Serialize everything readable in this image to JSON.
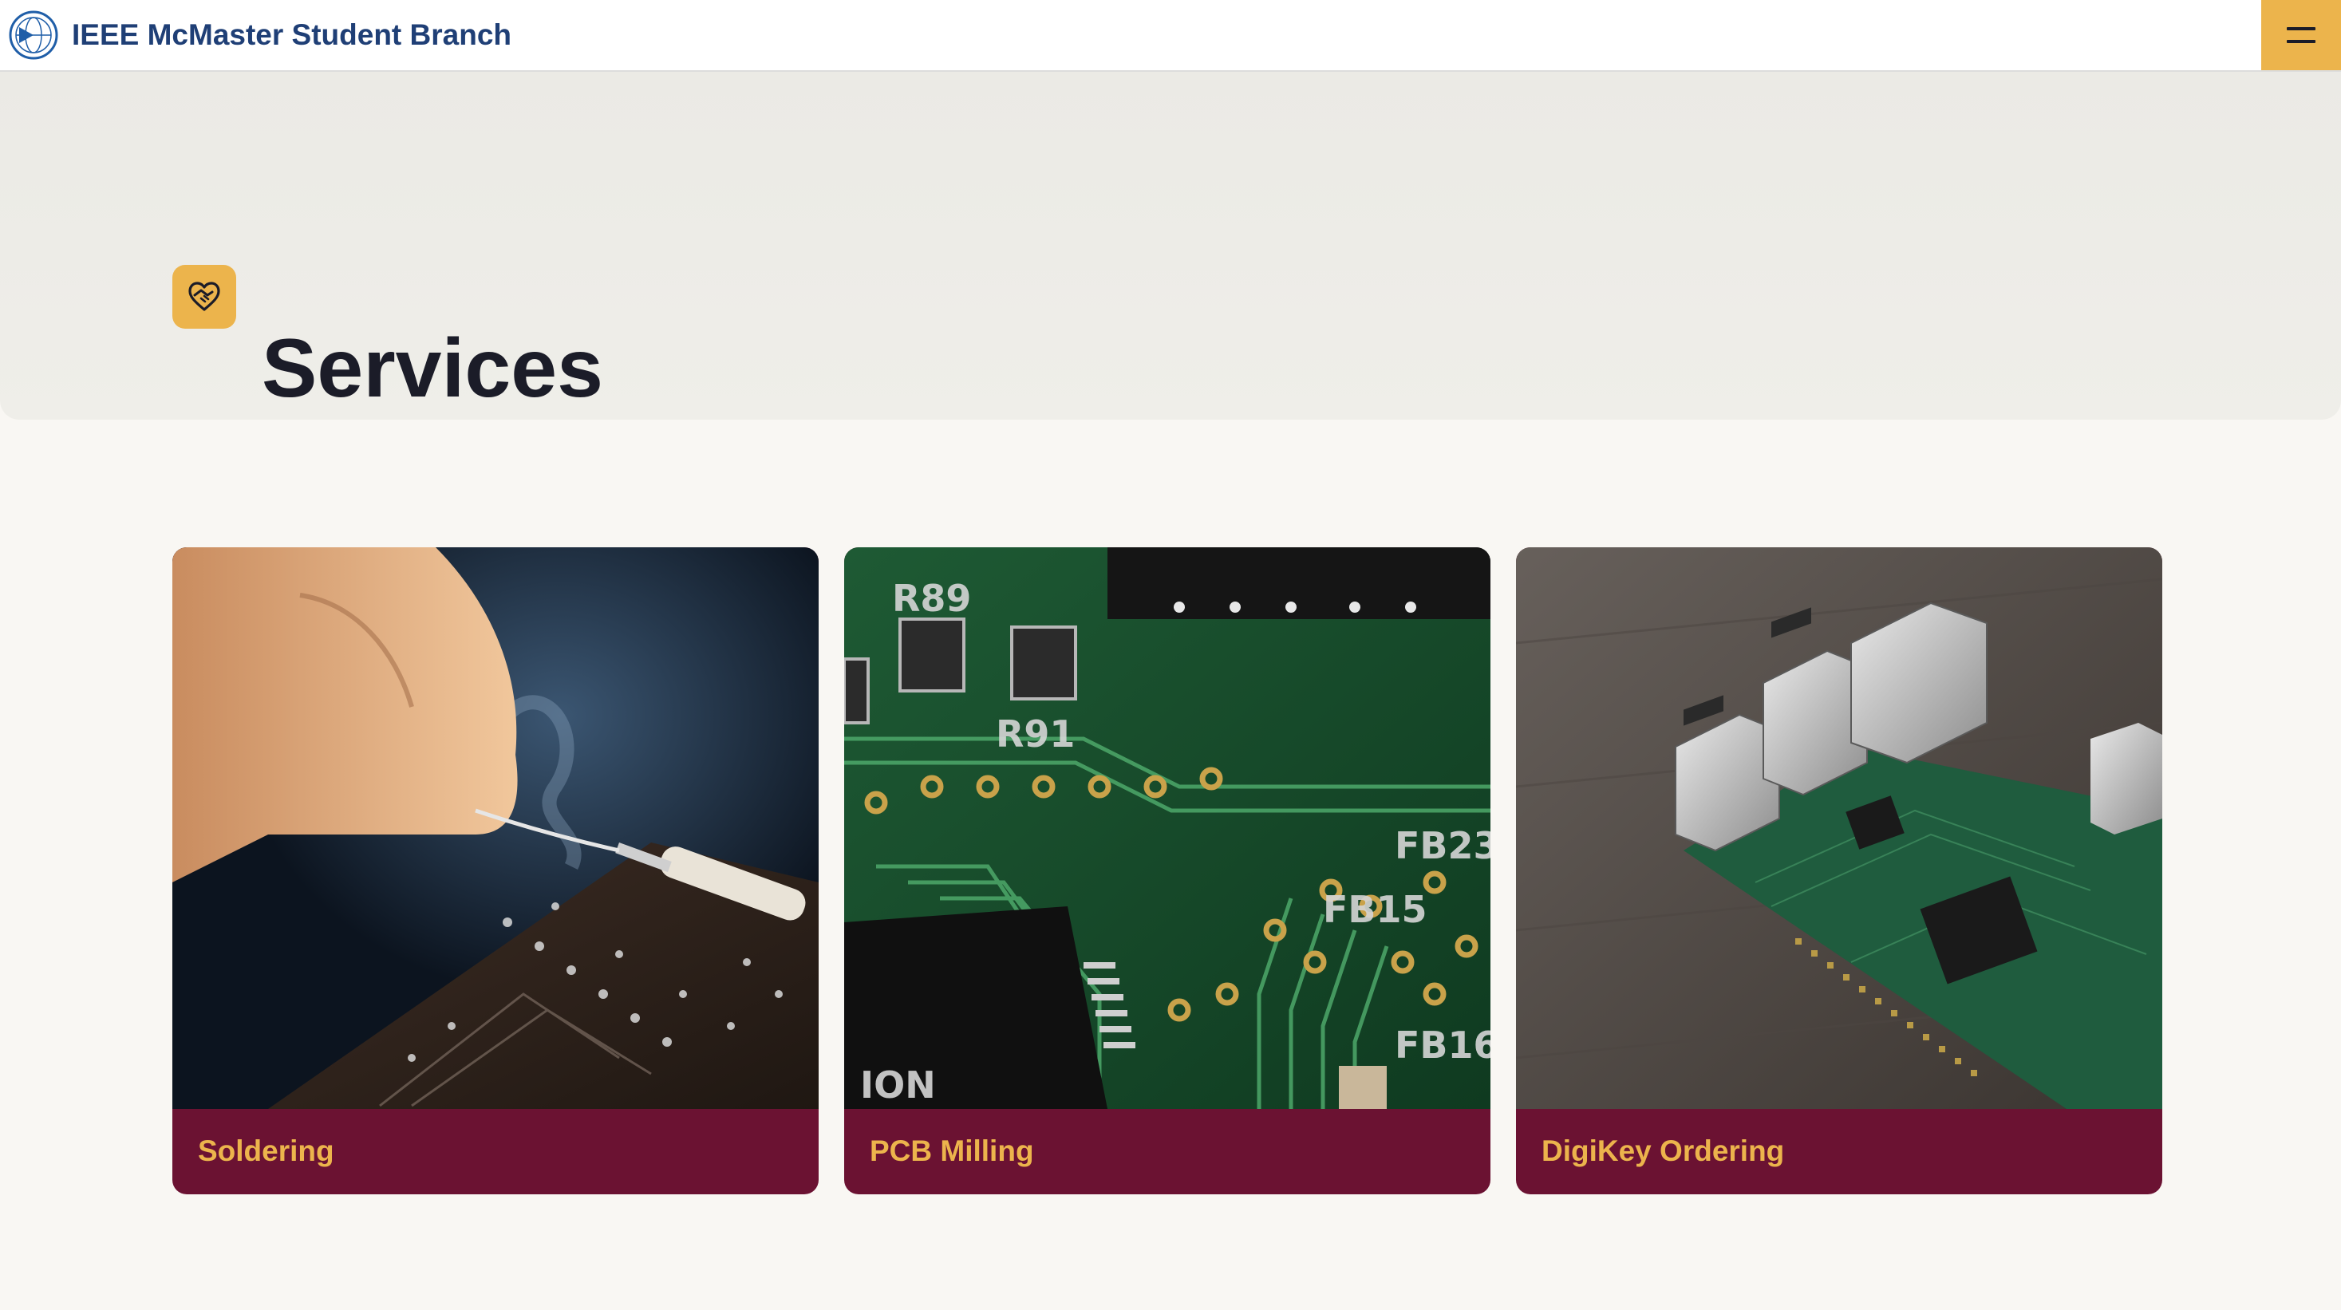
{
  "navbar": {
    "title": "IEEE McMaster Student Branch",
    "logo_icon": "ieee-globe-icon",
    "menu_icon": "hamburger-icon"
  },
  "hero": {
    "icon": "heart-handshake-icon",
    "title": "Services"
  },
  "services": [
    {
      "label": "Soldering",
      "image": "soldering-photo"
    },
    {
      "label": "PCB Milling",
      "image": "pcb-photo"
    },
    {
      "label": "DigiKey Ordering",
      "image": "raspberry-pi-photo"
    }
  ],
  "colors": {
    "accent": "#ecb44c",
    "card_footer": "#6b1232",
    "brand_text": "#1f3f76",
    "page_bg": "#f9f7f3"
  }
}
